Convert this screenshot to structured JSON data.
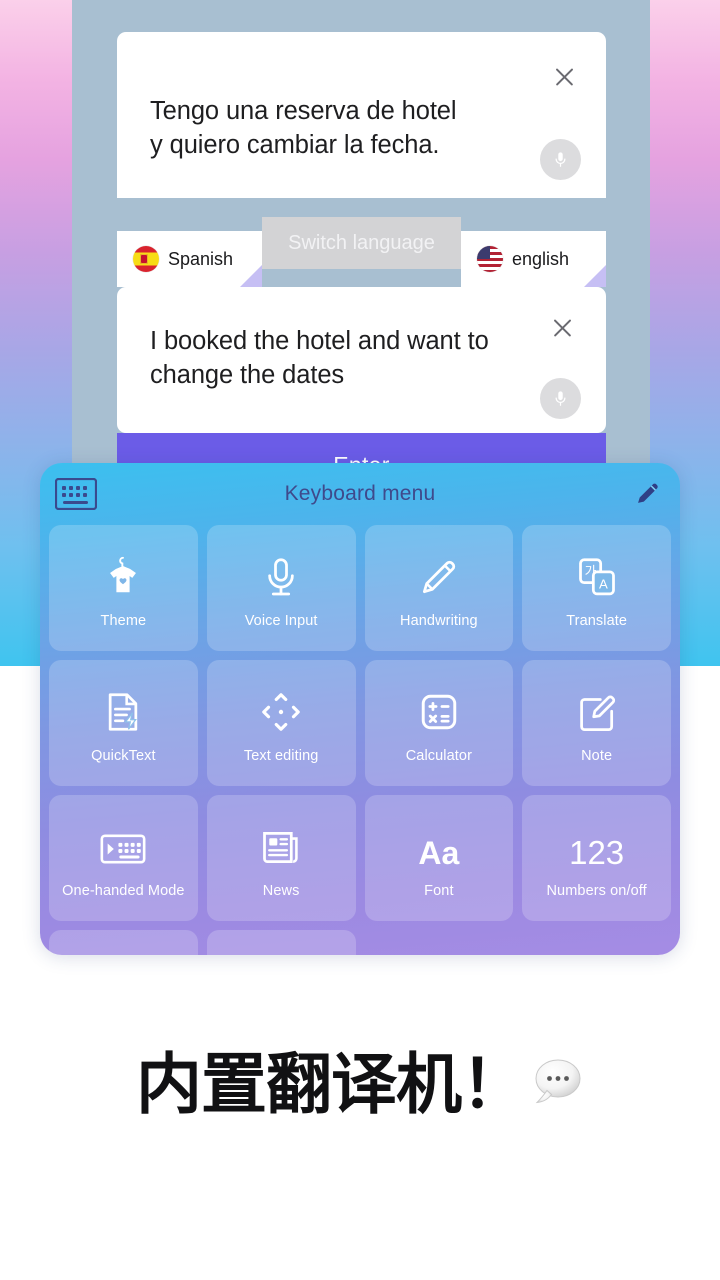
{
  "background": {
    "gradient_top": "#fbd0ea",
    "gradient_mid": "#a9a6e6",
    "gradient_bottom": "#3fc4ef",
    "device_panel_color": "#a8bfd1"
  },
  "translate_card": {
    "source": {
      "text": "Tengo una reserva de hotel y quiero cambiar la fecha.",
      "line1": "Tengo una reserva de hotel",
      "line2": "y quiero cambiar la fecha.",
      "close_icon": "close-icon",
      "mic_icon": "microphone-icon"
    },
    "target": {
      "text": "I booked the hotel and want to change the dates",
      "line1": "I booked the hotel and want to",
      "line2": "change the dates",
      "close_icon": "close-icon",
      "mic_icon": "microphone-icon"
    },
    "language_bar": {
      "source_language": "Spanish",
      "source_flag": "flag-spain-icon",
      "target_language": "english",
      "target_flag": "flag-usa-icon",
      "switch_label": "Switch language"
    },
    "enter_label": "Enter",
    "enter_color": "#6b5ce7"
  },
  "keyboard_menu": {
    "title": "Keyboard menu",
    "keyboard_icon": "keyboard-icon",
    "edit_icon": "pencil-edit-icon",
    "panel_gradient_top": "#3bc0ef",
    "panel_gradient_bottom": "#a58ce4",
    "tiles": [
      {
        "label": "Theme",
        "icon": "tshirt-hanger-icon"
      },
      {
        "label": "Voice Input",
        "icon": "microphone-icon"
      },
      {
        "label": "Handwriting",
        "icon": "pencil-icon"
      },
      {
        "label": "Translate",
        "icon": "translate-cards-icon"
      },
      {
        "label": "QuickText",
        "icon": "document-lightning-icon"
      },
      {
        "label": "Text editing",
        "icon": "four-arrows-icon"
      },
      {
        "label": "Calculator",
        "icon": "calculator-icon"
      },
      {
        "label": "Note",
        "icon": "note-pencil-icon"
      },
      {
        "label": "One-handed Mode",
        "icon": "one-handed-keyboard-icon"
      },
      {
        "label": "News",
        "icon": "newspaper-icon"
      },
      {
        "label": "Font",
        "icon": "font-aa-icon",
        "glyph": "Aa"
      },
      {
        "label": "Numbers on/off",
        "icon": "numbers-123-icon",
        "glyph": "123"
      }
    ],
    "partial_row_tiles": 2
  },
  "headline": {
    "text": "内置翻译机！",
    "bubble_icon": "speech-bubble-icon"
  }
}
